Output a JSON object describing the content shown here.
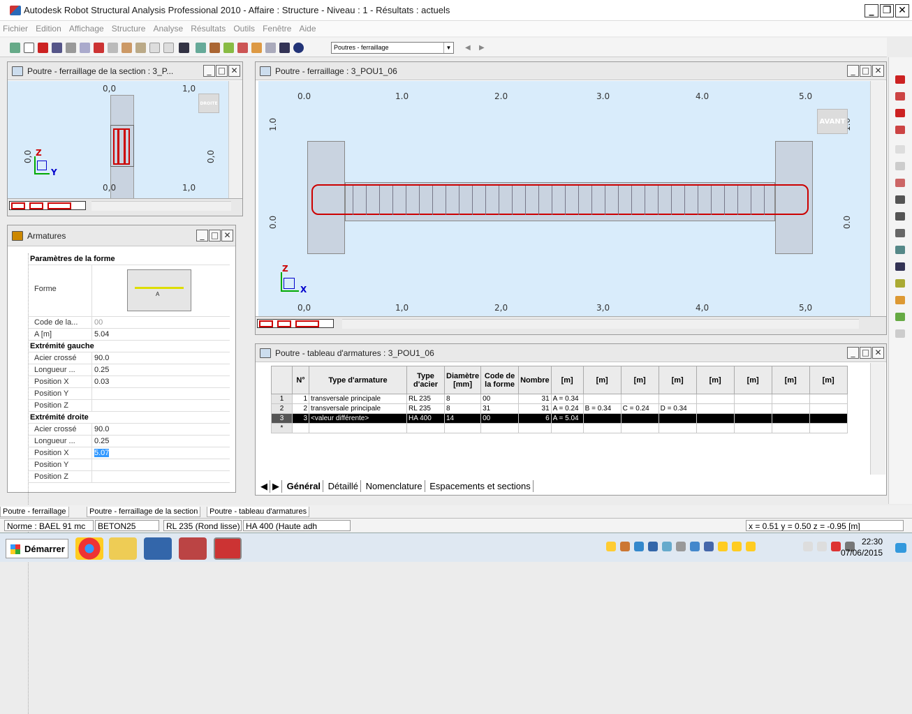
{
  "window": {
    "title": "Autodesk Robot Structural Analysis Professional 2010 - Affaire : Structure - Niveau : 1 - Résultats : actuels"
  },
  "menu": [
    "Fichier",
    "Edition",
    "Affichage",
    "Structure",
    "Analyse",
    "Résultats",
    "Outils",
    "Fenêtre",
    "Aide"
  ],
  "toolbar": {
    "combo_value": "Poutres - ferraillage"
  },
  "section_view": {
    "title": "Poutre - ferraillage de la section : 3_P...",
    "top_labels": [
      "0,0",
      "1,0"
    ],
    "bottom_labels": [
      "0,0",
      "1,0"
    ],
    "left_label": "0,0",
    "right_label": "0,0",
    "cube_label": "DROITE",
    "axis_z": "Z",
    "axis_y": "Y"
  },
  "main_view": {
    "title": "Poutre - ferraillage : 3_POU1_06",
    "top_labels": [
      "0.0",
      "1.0",
      "2.0",
      "3.0",
      "4.0",
      "5.0"
    ],
    "bottom_labels": [
      "0,0",
      "1,0",
      "2,0",
      "3,0",
      "4,0",
      "5,0"
    ],
    "left_labels": [
      "1.0",
      "0.0"
    ],
    "right_labels": [
      "1.0",
      "0.0"
    ],
    "cube_label": "AVANT",
    "axis_z": "Z",
    "axis_x": "X"
  },
  "armatures": {
    "title": "Armatures",
    "rows": [
      {
        "k": "Paramètres de la forme",
        "v": "",
        "sec": true
      },
      {
        "k": "Forme",
        "v": "",
        "shape": "A"
      },
      {
        "k": "Code de la...",
        "v": "00"
      },
      {
        "k": "A [m]",
        "v": "5.04"
      },
      {
        "k": "Extrémité gauche",
        "v": "",
        "sec": true
      },
      {
        "k": "Acier crossé",
        "v": "90.0"
      },
      {
        "k": "Longueur ...",
        "v": "0.25"
      },
      {
        "k": "Position X",
        "v": "0.03"
      },
      {
        "k": "Position Y",
        "v": ""
      },
      {
        "k": "Position Z",
        "v": ""
      },
      {
        "k": "Extrémité droite",
        "v": "",
        "sec": true
      },
      {
        "k": "Acier crossé",
        "v": "90.0"
      },
      {
        "k": "Longueur ...",
        "v": "0.25"
      },
      {
        "k": "Position X",
        "v": "5.07",
        "hl": true
      },
      {
        "k": "Position Y",
        "v": ""
      },
      {
        "k": "Position Z",
        "v": ""
      }
    ]
  },
  "table": {
    "title": "Poutre - tableau d'armatures : 3_POU1_06",
    "headers": [
      "N°",
      "Type d'armature",
      "Type d'acier",
      "Diamètre [mm]",
      "Code de la forme",
      "Nombre",
      "[m]",
      "[m]",
      "[m]",
      "[m]",
      "[m]",
      "[m]",
      "[m]",
      "[m]"
    ],
    "rows": [
      {
        "h": "1",
        "cells": [
          "1",
          "transversale principale",
          "RL 235",
          "8",
          "00",
          "31",
          "A = 0.34",
          "",
          "",
          "",
          "",
          "",
          "",
          ""
        ]
      },
      {
        "h": "2",
        "cells": [
          "2",
          "transversale principale",
          "RL 235",
          "8",
          "31",
          "31",
          "A = 0.24",
          "B = 0.34",
          "C = 0.24",
          "D = 0.34",
          "",
          "",
          "",
          ""
        ]
      },
      {
        "h": "3",
        "cells": [
          "3",
          "<valeur différente>",
          "HA 400",
          "14",
          "00",
          "6",
          "A = 5.04",
          "",
          "",
          "",
          "",
          "",
          "",
          ""
        ],
        "sel": true
      },
      {
        "h": "*",
        "cells": [
          "",
          "",
          "",
          "",
          "",
          "",
          "",
          "",
          "",
          "",
          "",
          "",
          "",
          ""
        ]
      }
    ],
    "tabs": [
      "Général",
      "Détaillé",
      "Nomenclature",
      "Espacements et sections"
    ]
  },
  "window_tabs": [
    "Poutre - ferraillage",
    "Poutre - ferraillage de la section",
    "Poutre - tableau d'armatures"
  ],
  "status": {
    "norme": "Norme : BAEL 91 mc",
    "beton": "BETON25",
    "acier1": "RL 235 (Rond lisse)",
    "acier2": "HA 400 (Haute adh",
    "coords": "x = 0.51  y = 0.50  z = -0.95   [m]"
  },
  "taskbar": {
    "start": "Démarrer",
    "time": "22:30",
    "date": "07/06/2015"
  }
}
